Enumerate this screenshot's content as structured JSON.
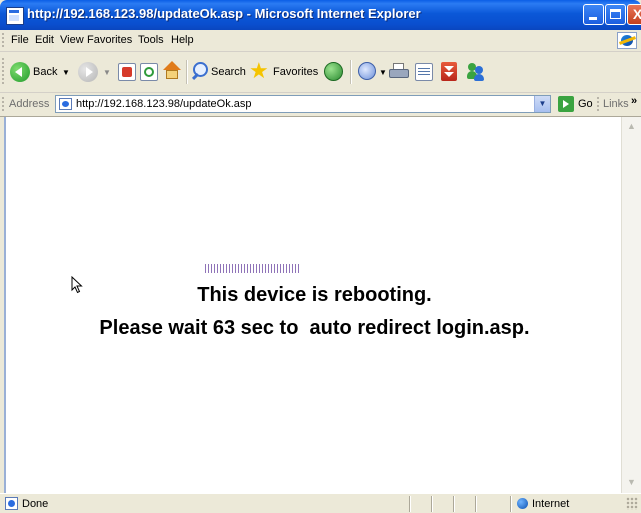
{
  "window": {
    "title": "http://192.168.123.98/updateOk.asp - Microsoft Internet Explorer",
    "minimize": "minimize",
    "maximize": "maximize",
    "close": "X"
  },
  "menu": {
    "items": [
      "File",
      "Edit",
      "View",
      "Favorites",
      "Tools",
      "Help"
    ]
  },
  "toolbar": {
    "back_label": "Back",
    "search_label": "Search",
    "favorites_label": "Favorites"
  },
  "address": {
    "label": "Address",
    "url": "http://192.168.123.98/updateOk.asp",
    "go_label": "Go",
    "links_label": "Links",
    "links_more": "»"
  },
  "content": {
    "message_line1": "This device is rebooting.",
    "message_line2": "Please wait 63 sec to  auto redirect login.asp.",
    "countdown_seconds": 63
  },
  "status": {
    "text": "Done",
    "zone": "Internet"
  },
  "colors": {
    "titlebar": "#0a4fcf",
    "progress": "#8f73b8",
    "content_bg": "#ffffff"
  }
}
